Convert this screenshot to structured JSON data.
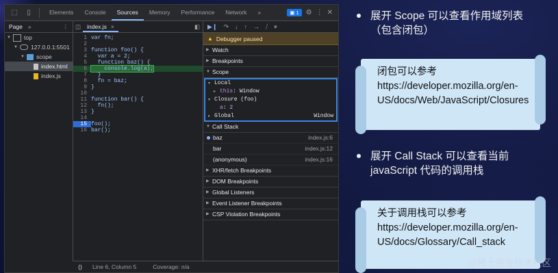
{
  "devtools": {
    "tabs": [
      "Elements",
      "Console",
      "Sources",
      "Memory",
      "Performance",
      "Network"
    ],
    "active_tab": "Sources",
    "more_tabs": "»",
    "issues_count": "1",
    "navigator": {
      "tab_label": "Page",
      "more": "»",
      "tree": [
        {
          "label": "top",
          "level": 0,
          "icon": "frame-icon"
        },
        {
          "label": "127.0.0.1:5501",
          "level": 1,
          "icon": "cloud-icon"
        },
        {
          "label": "scope",
          "level": 2,
          "icon": "folder-icon"
        },
        {
          "label": "index.html",
          "level": 3,
          "icon": "html-file-icon"
        },
        {
          "label": "index.js",
          "level": 3,
          "icon": "js-file-icon"
        }
      ]
    },
    "editor": {
      "file_tab": "index.js",
      "lines": [
        {
          "n": "1",
          "code": "var fn;"
        },
        {
          "n": "2",
          "code": ""
        },
        {
          "n": "3",
          "code": "function foo() {"
        },
        {
          "n": "4",
          "code": "  var a = 2;"
        },
        {
          "n": "5",
          "code": "  function baz() {"
        },
        {
          "n": "6",
          "code": "    console.log(a);"
        },
        {
          "n": "7",
          "code": "  }"
        },
        {
          "n": "8",
          "code": "  fn = baz;"
        },
        {
          "n": "9",
          "code": "}"
        },
        {
          "n": "10",
          "code": ""
        },
        {
          "n": "11",
          "code": "function bar() {"
        },
        {
          "n": "12",
          "code": "  fn();"
        },
        {
          "n": "13",
          "code": "}"
        },
        {
          "n": "14",
          "code": ""
        },
        {
          "n": "15",
          "code": "foo();"
        },
        {
          "n": "16",
          "code": "bar();"
        }
      ],
      "current_line": "6",
      "breakpoint_line": "15"
    },
    "debugger": {
      "paused_text": "Debugger paused",
      "sections_top": [
        "Watch",
        "Breakpoints",
        "Scope"
      ],
      "scope": [
        {
          "arrow": "▾",
          "name": "Local",
          "value": "",
          "indent": 0
        },
        {
          "arrow": "▸",
          "name": "this",
          "value": "Window",
          "indent": 1
        },
        {
          "arrow": "▾",
          "name": "Closure (foo)",
          "value": "",
          "indent": 0
        },
        {
          "arrow": "",
          "name": "a",
          "value": "2",
          "indent": 1
        },
        {
          "arrow": "▸",
          "name": "Global",
          "value": "Window",
          "indent": 0
        }
      ],
      "call_stack_label": "Call Stack",
      "call_stack": [
        {
          "fn": "baz",
          "loc": "index.js:6"
        },
        {
          "fn": "bar",
          "loc": "index.js:12"
        },
        {
          "fn": "(anonymous)",
          "loc": "index.js:16"
        }
      ],
      "sections_bottom": [
        "XHR/fetch Breakpoints",
        "DOM Breakpoints",
        "Global Listeners",
        "Event Listener Breakpoints",
        "CSP Violation Breakpoints"
      ]
    },
    "status": {
      "braces": "{}",
      "position": "Line 6, Column 5",
      "coverage": "Coverage: n/a"
    }
  },
  "slide": {
    "bullet1": "展开 Scope 可以查看作用域列表（包含闭包）",
    "note1": {
      "title": "闭包可以参考",
      "url_lines": [
        "https://developer.mozilla.org/en-",
        "US/docs/Web/JavaScript/Closures"
      ]
    },
    "bullet2": "展开 Call Stack 可以查看当前 javaScript 代码的调用栈",
    "note2": {
      "title": "关于调用栈可以参考",
      "url_lines": [
        "https://developer.mozilla.org/en-",
        "US/docs/Glossary/Call_stack"
      ]
    },
    "watermark": "@稀土掘金技术社区"
  },
  "colors": {
    "accent": "#8ab4f8",
    "paused_bg": "#4f4126",
    "exec_line": "#1f4a2b",
    "note_bg": "#cfe6f7"
  }
}
